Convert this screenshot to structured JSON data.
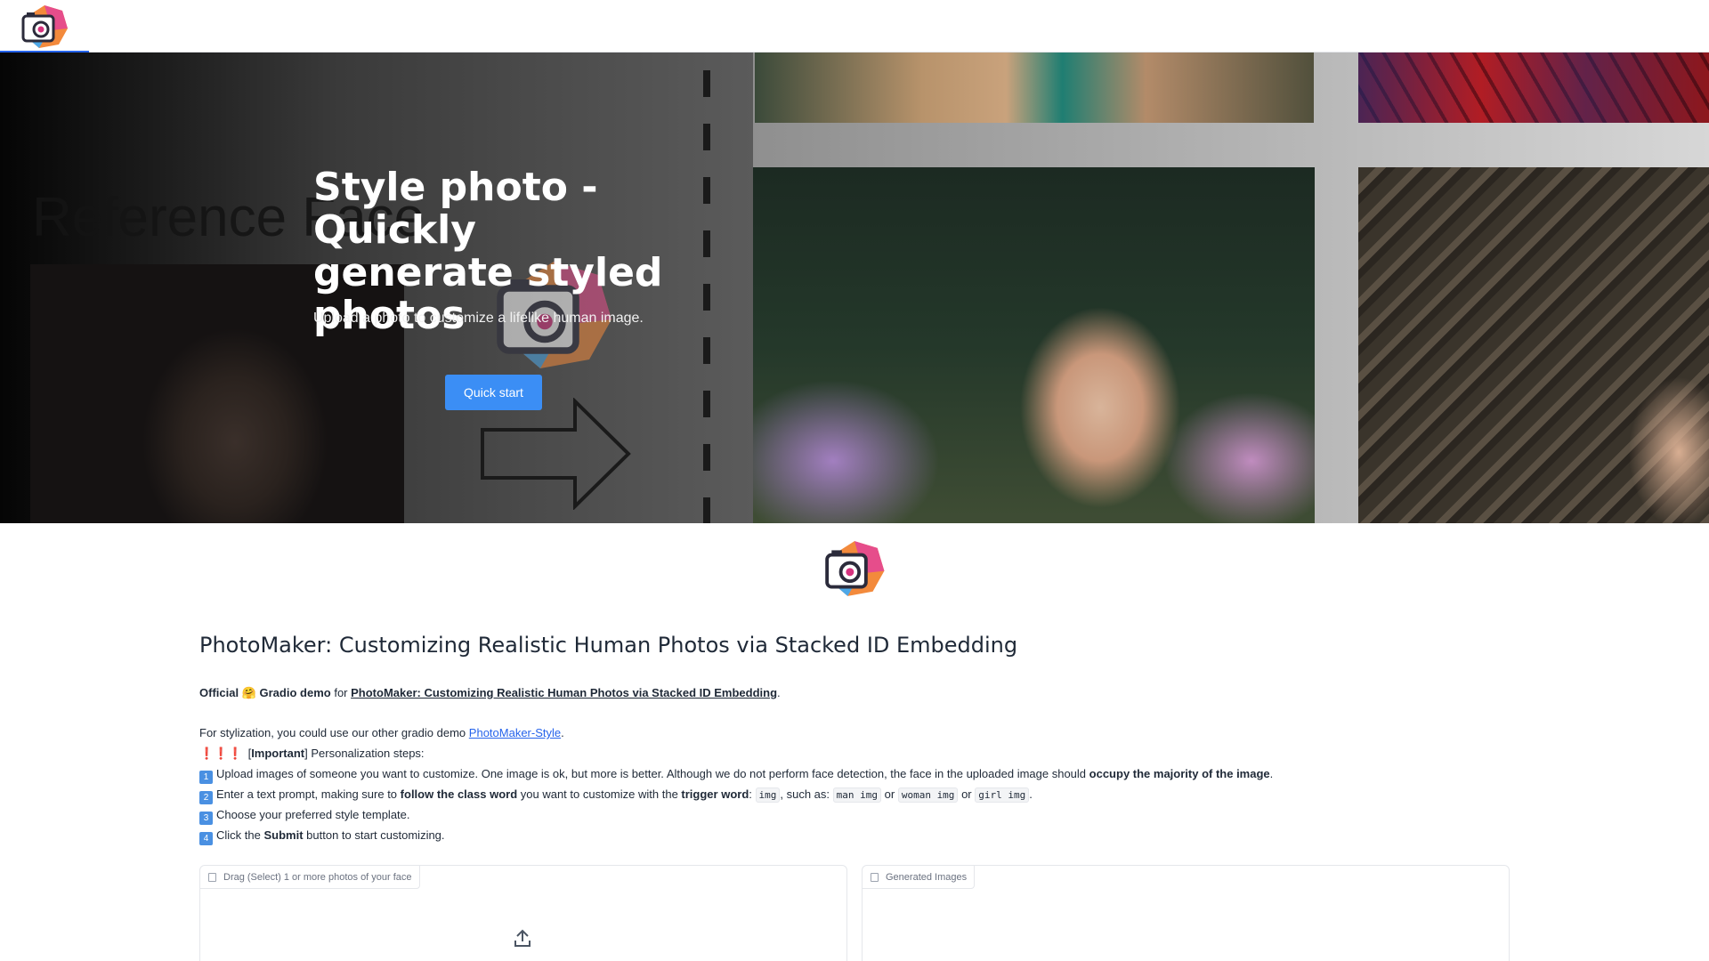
{
  "colors": {
    "accent": "#3b8ef5",
    "link": "#2563eb",
    "text": "#1f2937",
    "muted": "#6b7280"
  },
  "topbar": {
    "logo_icon": "camera-logo-icon"
  },
  "hero": {
    "reference_label": "Reference Face",
    "title": "Style photo - Quickly generate styled photos",
    "subtitle": "Upload a photo to customize a lifelike human image.",
    "cta_label": "Quick start"
  },
  "main": {
    "title": "PhotoMaker: Customizing Realistic Human Photos via Stacked ID Embedding",
    "official": {
      "prefix": "Official",
      "emoji": "🤗",
      "gradio": "Gradio demo",
      "for": "for",
      "link_text": "PhotoMaker: Customizing Realistic Human Photos via Stacked ID Embedding",
      "suffix": "."
    },
    "stylization": {
      "text": "For stylization, you could use our other gradio demo",
      "link_text": "PhotoMaker-Style",
      "suffix": "."
    },
    "important": {
      "marks": "❗❗❗",
      "open_bracket": "[",
      "label": "Important",
      "close_text": "] Personalization steps:"
    },
    "steps": [
      {
        "num": "1",
        "a": "Upload images of someone you want to customize. One image is ok, but more is better. Although we do not perform face detection, the face in the uploaded image should",
        "b": "occupy the majority of the image",
        "c": "."
      },
      {
        "num": "2",
        "a": "Enter a text prompt, making sure to",
        "b": "follow the class word",
        "c": "you want to customize with the",
        "d": "trigger word",
        "e": ":",
        "code1": "img",
        "f": ", such as:",
        "code2": "man img",
        "g": "or",
        "code3": "woman img",
        "h": "or",
        "code4": "girl img",
        "i": "."
      },
      {
        "num": "3",
        "a": "Choose your preferred style template."
      },
      {
        "num": "4",
        "a": "Click the",
        "b": "Submit",
        "c": "button to start customizing."
      }
    ]
  },
  "panels": {
    "upload_label": "Drag (Select) 1 or more photos of your face",
    "upload_icon": "upload-icon",
    "generated_label": "Generated Images",
    "generated_icon": "image-icon"
  }
}
